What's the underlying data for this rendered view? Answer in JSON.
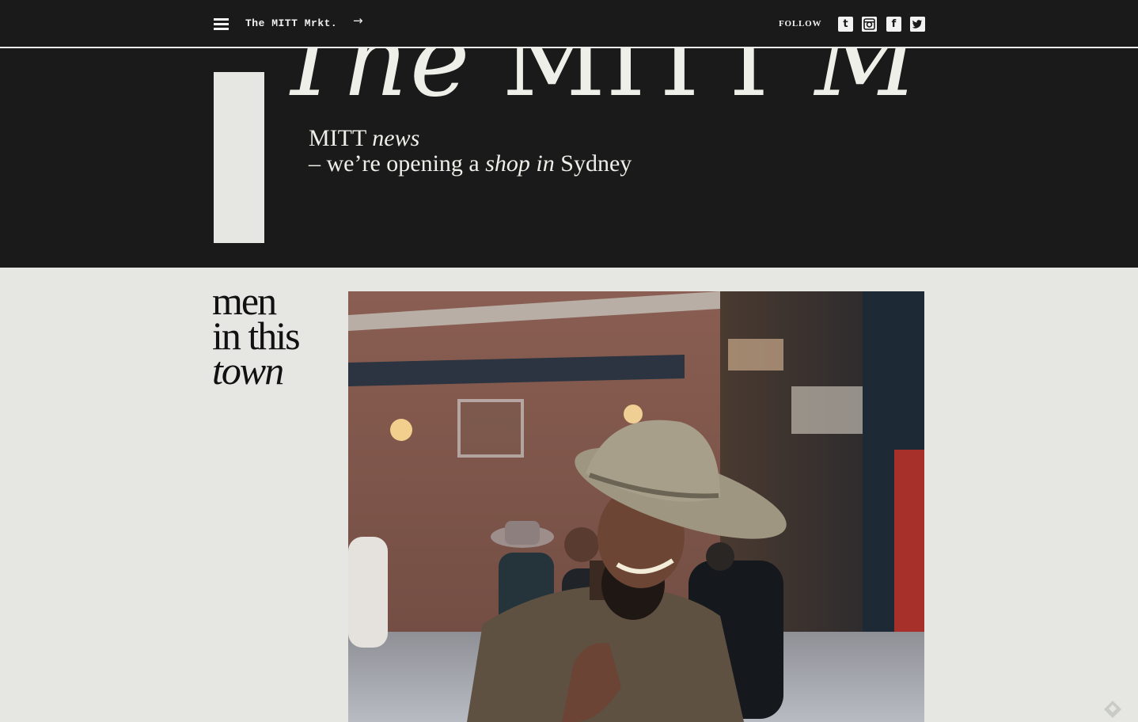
{
  "nav": {
    "brand": "The MITT Mrkt.",
    "arrow": "→",
    "follow": "FOLLOW",
    "social": [
      {
        "name": "tumblr",
        "glyph": "t"
      },
      {
        "name": "instagram",
        "glyph": "◙"
      },
      {
        "name": "facebook",
        "glyph": "f"
      },
      {
        "name": "twitter",
        "glyph": "🐦"
      }
    ]
  },
  "hero": {
    "masthead_word1": "The",
    "masthead_word2": "MITT",
    "masthead_word3": "Mrkt",
    "news_title_plain": "MITT",
    "news_title_italic": "news",
    "news_line2_a": "– we’re opening a",
    "news_line2_italic": "shop in",
    "news_line2_b": "Sydney"
  },
  "section": {
    "title_line1": "men",
    "title_line2": "in this",
    "title_line3": "town"
  },
  "colors": {
    "dark": "#1a1a1a",
    "light": "#e6e6e2",
    "cream": "#efefe9"
  }
}
